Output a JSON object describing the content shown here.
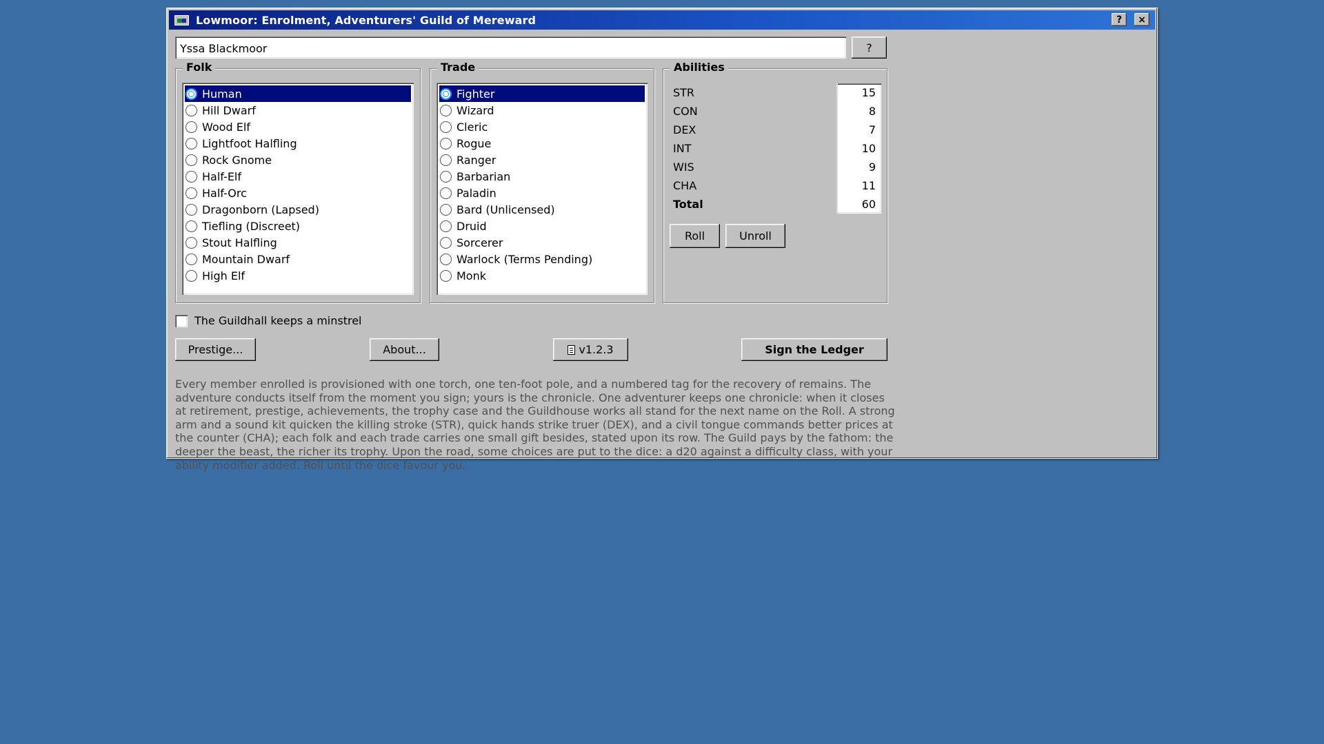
{
  "window": {
    "title": "Lowmoor: Enrolment, Adventurers' Guild of Mereward",
    "help_label": "?",
    "close_label": "×"
  },
  "name_field": {
    "value": "Yssa Blackmoor",
    "help_button": "?"
  },
  "folk": {
    "label": "Folk",
    "selected": "Human",
    "items": [
      "Human",
      "Hill Dwarf",
      "Wood Elf",
      "Lightfoot Halfling",
      "Rock Gnome",
      "Half-Elf",
      "Half-Orc",
      "Dragonborn (Lapsed)",
      "Tiefling (Discreet)",
      "Stout Halfling",
      "Mountain Dwarf",
      "High Elf"
    ]
  },
  "trade": {
    "label": "Trade",
    "selected": "Fighter",
    "items": [
      "Fighter",
      "Wizard",
      "Cleric",
      "Rogue",
      "Ranger",
      "Barbarian",
      "Paladin",
      "Bard (Unlicensed)",
      "Druid",
      "Sorcerer",
      "Warlock (Terms Pending)",
      "Monk"
    ]
  },
  "abilities": {
    "label": "Abilities",
    "rows": [
      {
        "label": "STR",
        "value": "15"
      },
      {
        "label": "CON",
        "value": "8"
      },
      {
        "label": "DEX",
        "value": "7"
      },
      {
        "label": "INT",
        "value": "10"
      },
      {
        "label": "WIS",
        "value": "9"
      },
      {
        "label": "CHA",
        "value": "11"
      },
      {
        "label": "Total",
        "value": "60"
      }
    ],
    "roll_label": "Roll",
    "unroll_label": "Unroll"
  },
  "minstrel": {
    "label": "The Guildhall keeps a minstrel",
    "checked": false
  },
  "buttons": {
    "prestige": "Prestige...",
    "about": "About...",
    "version": "v1.2.3",
    "sign": "Sign the Ledger"
  },
  "info_text": "Every member enrolled is provisioned with one torch, one ten-foot pole, and a numbered tag for the recovery of remains. The adventure conducts itself from the moment you sign; yours is the chronicle. One adventurer keeps one chronicle: when it closes at retirement, prestige, achievements, the trophy case and the Guildhouse works all stand for the next name on the Roll. A strong arm and a sound kit quicken the killing stroke (STR), quick hands strike truer (DEX), and a civil tongue commands better prices at the counter (CHA); each folk and each trade carries one small gift besides, stated upon its row. The Guild pays by the fathom: the deeper the beast, the richer its trophy. Upon the road, some choices are put to the dice: a d20 against a difficulty class, with your ability modifier added. Roll until the dice favour you.",
  "colors": {
    "desktop": "#3b6ea5",
    "titlebar": "#0a1e82",
    "selection": "#000c7c",
    "face": "#c0c0c0"
  }
}
